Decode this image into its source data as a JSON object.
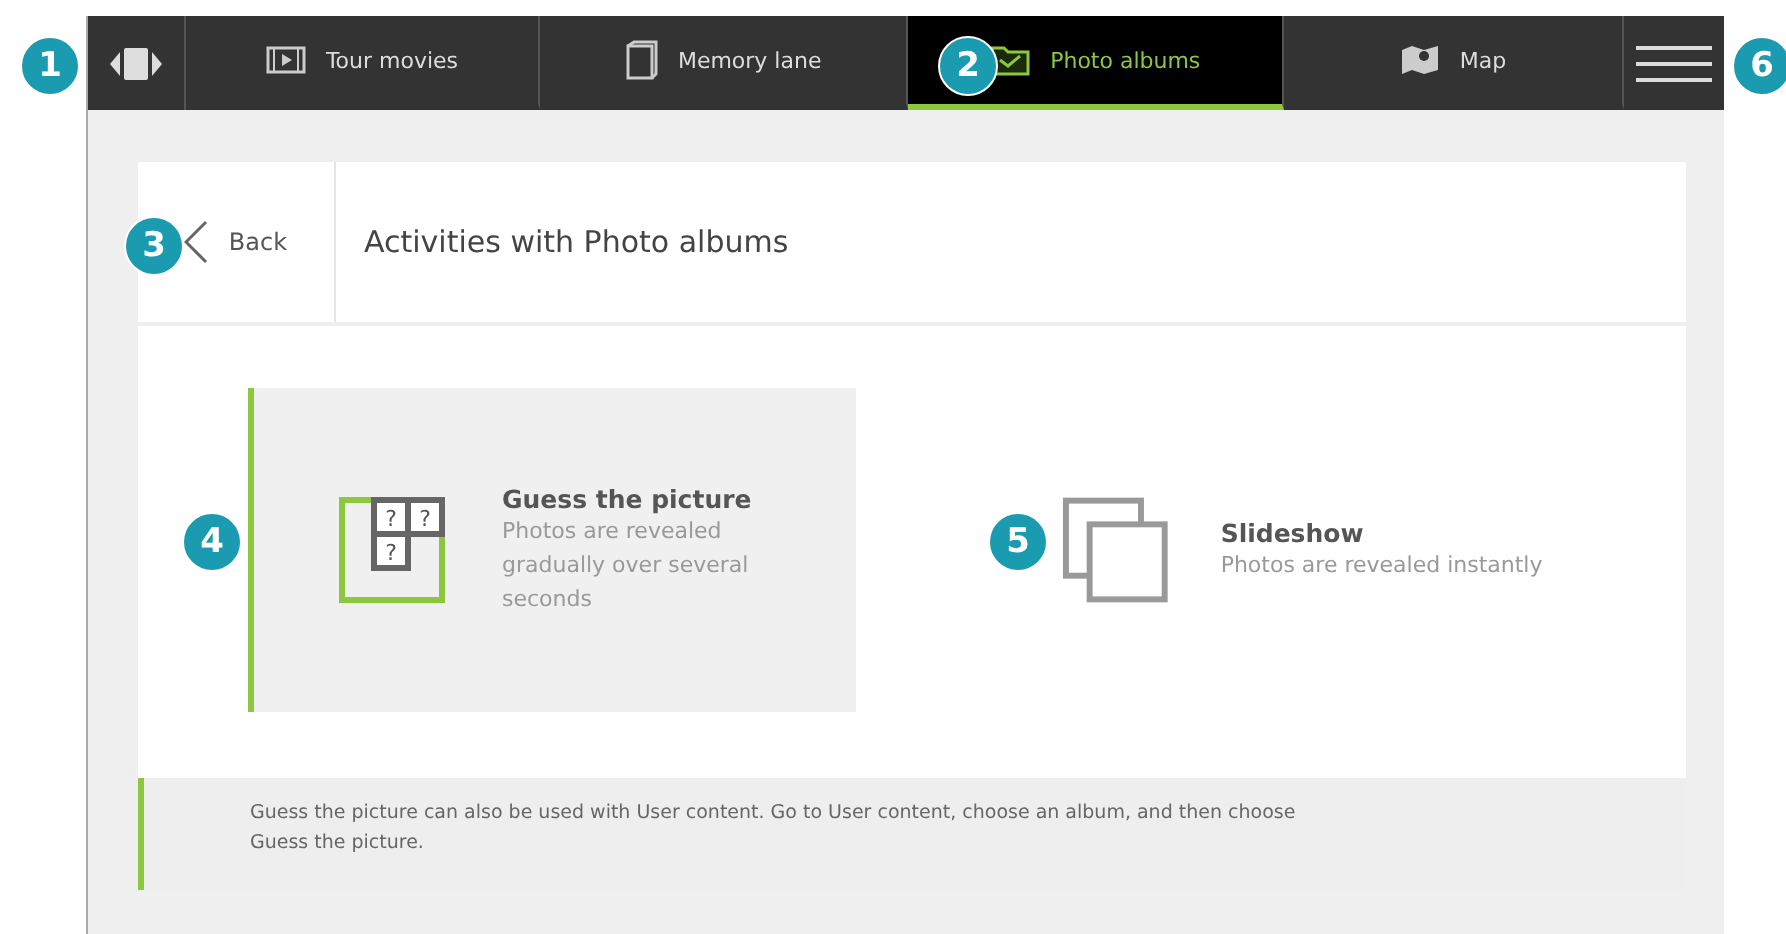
{
  "nav": {
    "tabs": [
      {
        "label": "Tour movies",
        "selected": false
      },
      {
        "label": "Memory lane",
        "selected": false
      },
      {
        "label": "Photo albums",
        "selected": true
      },
      {
        "label": "Map",
        "selected": false
      }
    ]
  },
  "header": {
    "back": "Back",
    "title": "Activities with Photo albums"
  },
  "activities": [
    {
      "kind": "guess",
      "title": "Guess the picture",
      "description": "Photos are revealed gradually over several seconds",
      "selected": true,
      "marks": [
        "?",
        "?",
        "?"
      ]
    },
    {
      "kind": "slideshow",
      "title": "Slideshow",
      "description": "Photos are revealed instantly",
      "selected": false
    }
  ],
  "note": "Guess the picture can also be used with User content. Go to User content, choose an album, and then choose Guess the picture.",
  "callouts": [
    "1",
    "2",
    "3",
    "4",
    "5",
    "6"
  ]
}
